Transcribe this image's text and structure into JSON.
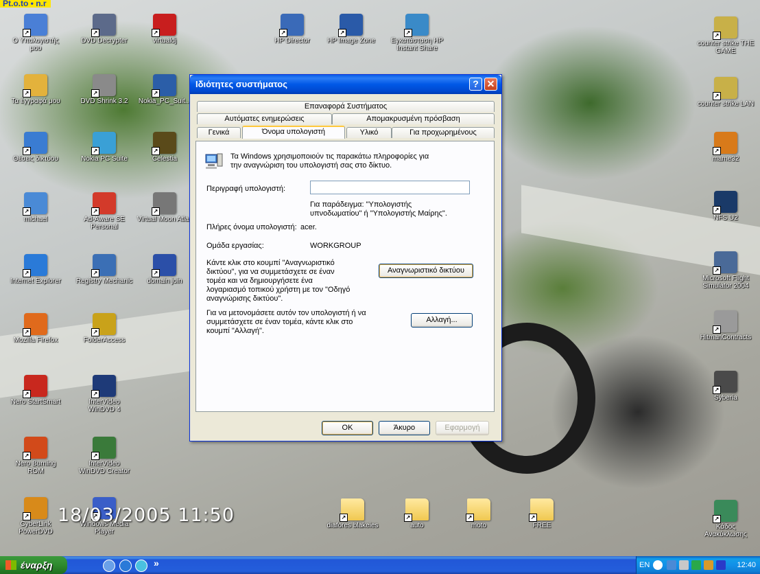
{
  "corner_label": "Pt.o.to • n.r",
  "timestamp": "18/03/2005 11:50",
  "desktop_icons_left": [
    {
      "name": "my-computer-icon",
      "label": "Ο Υπολογιστής μου",
      "color": "#4a7fd6"
    },
    {
      "name": "dvd-decrypter-icon",
      "label": "DVD Decrypter",
      "color": "#5c6a8a"
    },
    {
      "name": "virtualdj-icon",
      "label": "virtualdj",
      "color": "#c81e1e"
    },
    {
      "name": "my-documents-icon",
      "label": "Τα έγγραφά μου",
      "color": "#e3b23c"
    },
    {
      "name": "dvd-shrink-icon",
      "label": "DVD Shrink 3.2",
      "color": "#8a8a8a"
    },
    {
      "name": "nokia-pc-suite-shortcut-icon",
      "label": "Nokia_PC_Suit...",
      "color": "#2b5ea8"
    },
    {
      "name": "network-places-icon",
      "label": "Θέσεις δικτύου",
      "color": "#3a7cd2"
    },
    {
      "name": "nokia-pc-suite-icon",
      "label": "Nokia PC Suite",
      "color": "#3aa0d6"
    },
    {
      "name": "celestia-icon",
      "label": "Celestia",
      "color": "#5a4a1a"
    },
    {
      "name": "user-michael-icon",
      "label": "michael",
      "color": "#4a8ad6"
    },
    {
      "name": "ad-aware-icon",
      "label": "Ad-Aware SE Personal",
      "color": "#d33a2a"
    },
    {
      "name": "virtual-moon-atlas-icon",
      "label": "Virtual Moon Atlas",
      "color": "#777777"
    },
    {
      "name": "internet-explorer-icon",
      "label": "Internet Explorer",
      "color": "#2a7ad8"
    },
    {
      "name": "registry-mechanic-icon",
      "label": "Registry Mechanic",
      "color": "#3b6fb5"
    },
    {
      "name": "word-document-icon",
      "label": "domain join",
      "color": "#2b4fa8"
    },
    {
      "name": "mozilla-firefox-icon",
      "label": "Mozilla Firefox",
      "color": "#e06a1c"
    },
    {
      "name": "folder-access-icon",
      "label": "FolderAccess",
      "color": "#c9a21a"
    },
    {
      "name": "nero-startsmart-icon",
      "label": "Nero StartSmart",
      "color": "#c8281e"
    },
    {
      "name": "intervideo-windvd-icon",
      "label": "InterVideo WinDVD 4",
      "color": "#1e3a78"
    },
    {
      "name": "nero-burning-rom-icon",
      "label": "Nero Burning ROM",
      "color": "#d24a1a"
    },
    {
      "name": "intervideo-windvd-creator-icon",
      "label": "InterVideo WinDVD Creator",
      "color": "#3a7a3a"
    },
    {
      "name": "cyberlink-powerdvd-icon",
      "label": "CyberLink PowerDVD",
      "color": "#d88a1a"
    },
    {
      "name": "windows-media-player-icon",
      "label": "Windows Media Player",
      "color": "#3a5ec8"
    }
  ],
  "desktop_icons_top": [
    {
      "name": "hp-director-icon",
      "label": "HP Director",
      "color": "#3a6ab8"
    },
    {
      "name": "hp-image-zone-icon",
      "label": "HP Image Zone",
      "color": "#2a5aa8"
    },
    {
      "name": "hp-instant-share-icon",
      "label": "Εγκατάσταση HP Instant Share",
      "color": "#3a8ac8"
    }
  ],
  "desktop_icons_right": [
    {
      "name": "counter-strike-game-icon",
      "label": "counter strike THE GAME",
      "color": "#c8b048"
    },
    {
      "name": "counter-strike-lan-icon",
      "label": "counter strike LAN",
      "color": "#c8b048"
    },
    {
      "name": "mame32-icon",
      "label": "mame32",
      "color": "#d87a1a"
    },
    {
      "name": "nfs-u2-icon",
      "label": "NFS U2",
      "color": "#1a3a68"
    },
    {
      "name": "flight-simulator-icon",
      "label": "Microsoft Flight Simulator 2004",
      "color": "#4a6a98"
    },
    {
      "name": "hitman-contracts-icon",
      "label": "HitmanContracts",
      "color": "#9a9a9a"
    },
    {
      "name": "syberia-icon",
      "label": "Syberia",
      "color": "#4a4a4a"
    },
    {
      "name": "recycle-bin-icon",
      "label": "Κάδος Ανακύκλωσης",
      "color": "#3a8a5a"
    }
  ],
  "desktop_folders": [
    {
      "name": "folder-diafores-blakeies-icon",
      "label": "diafores blakeies"
    },
    {
      "name": "folder-auto-icon",
      "label": "auto"
    },
    {
      "name": "folder-moto-icon",
      "label": "moto"
    },
    {
      "name": "folder-free-icon",
      "label": "FREE"
    }
  ],
  "dialog": {
    "title": "Ιδιότητες συστήματος",
    "help_glyph": "?",
    "close_glyph": "✕",
    "tabs_row1": [
      "Επαναφορά Συστήματος"
    ],
    "tabs_row2": [
      "Αυτόματες ενημερώσεις",
      "Απομακρυσμένη πρόσβαση"
    ],
    "tabs_row3": [
      "Γενικά",
      "Όνομα υπολογιστή",
      "Υλικό",
      "Για προχωρημένους"
    ],
    "active_tab": "Όνομα υπολογιστή",
    "intro_line1": "Τα Windows χρησιμοποιούν τις παρακάτω πληροφορίες για",
    "intro_line2": "την αναγνώριση του υπολογιστή σας στο δίκτυο.",
    "description_label": "Περιγραφή υπολογιστή:",
    "description_value": "",
    "example_line1": "Για παράδειγμα: \"Υπολογιστής",
    "example_line2": "υπνοδωματίου\" ή \"Υπολογιστής Μαίρης\".",
    "full_name_label": "Πλήρες όνομα υπολογιστή:",
    "full_name_value": "acer.",
    "workgroup_label": "Ομάδα εργασίας:",
    "workgroup_value": "WORKGROUP",
    "network_id_text": [
      "Κάντε κλικ στο κουμπί \"Αναγνωριστικό",
      "δικτύου\", για να συμμετάσχετε σε έναν",
      "τομέα και να δημιουργήσετε ένα",
      "λογαριασμό τοπικού χρήστη με τον \"Οδηγό",
      "αναγνώρισης δικτύου\"."
    ],
    "network_id_button": "Αναγνωριστικό δικτύου",
    "change_text": [
      "Για να μετονομάσετε αυτόν τον υπολογιστή ή να",
      "συμμετάσχετε σε έναν τομέα, κάντε κλικ στο",
      "κουμπί \"Αλλαγή\"."
    ],
    "change_button": "Αλλαγή...",
    "ok_button": "OK",
    "cancel_button": "Άκυρο",
    "apply_button": "Εφαρμογή"
  },
  "taskbar": {
    "start_label": "έναρξη",
    "quicklaunch_more": "»",
    "language": "EN",
    "clock": "12:40"
  }
}
